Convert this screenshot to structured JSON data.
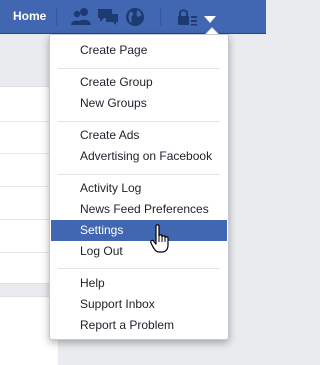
{
  "topbar": {
    "home_label": "Home",
    "icons": [
      "friends-icon",
      "messages-icon",
      "notifications-globe-icon",
      "privacy-lock-icon",
      "account-menu-caret-icon"
    ],
    "bg_color": "#4267b2"
  },
  "menu": {
    "groups": [
      [
        "Create Page"
      ],
      [
        "Create Group",
        "New Groups"
      ],
      [
        "Create Ads",
        "Advertising on Facebook"
      ],
      [
        "Activity Log",
        "News Feed Preferences",
        "Settings",
        "Log Out"
      ],
      [
        "Help",
        "Support Inbox",
        "Report a Problem"
      ]
    ],
    "active_item": "Settings",
    "highlight_color": "#4267b2"
  }
}
